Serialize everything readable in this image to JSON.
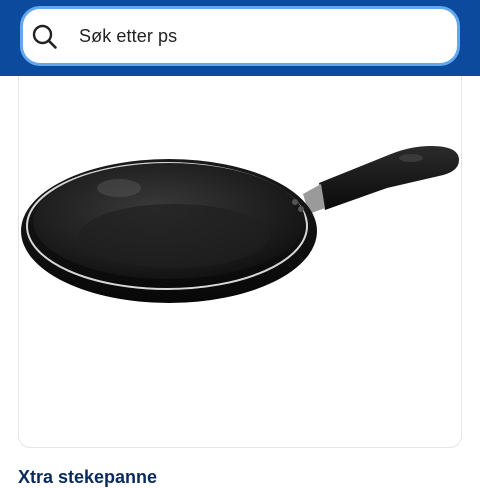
{
  "search": {
    "text": "Søk etter ps",
    "icon": "search-icon"
  },
  "product": {
    "image_icon": "frying-pan-image",
    "title": "Xtra stekepanne"
  },
  "colors": {
    "header_bg": "#0b4a9c",
    "search_border": "#63a8ee",
    "title_color": "#0b2a5c"
  }
}
